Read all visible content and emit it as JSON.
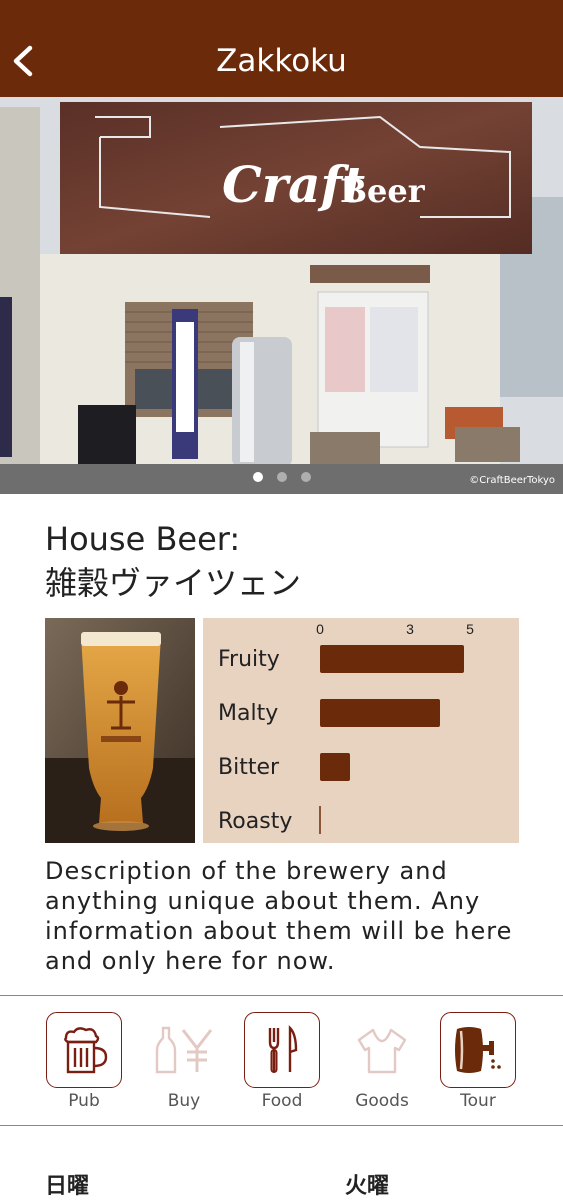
{
  "header": {
    "title": "Zakkoku",
    "back_icon": "chevron-left-icon"
  },
  "gallery": {
    "slide_count": 3,
    "active_index": 0,
    "watermark": "©CraftBeerTokyo",
    "sign_text": "Craft Beer"
  },
  "beer": {
    "heading": "House Beer:",
    "name": "雑穀ヴァイツェン"
  },
  "chart_data": {
    "type": "bar",
    "orientation": "horizontal",
    "categories": [
      "Fruity",
      "Malty",
      "Bitter",
      "Roasty"
    ],
    "values": [
      4.8,
      4.0,
      1.0,
      0
    ],
    "xlim": [
      0,
      5
    ],
    "ticks": [
      "0",
      "3",
      "5"
    ],
    "bar_color": "#6b2a0a",
    "background": "#e8d3c0",
    "grid": false
  },
  "description": "Description of the brewery and anything unique about them. Any information about them will be here and only here for now.",
  "amenities": [
    {
      "label": "Pub",
      "icon": "beer-mug-icon",
      "enabled": true
    },
    {
      "label": "Buy",
      "icon": "bottle-yen-icon",
      "enabled": false
    },
    {
      "label": "Food",
      "icon": "fork-knife-icon",
      "enabled": true
    },
    {
      "label": "Goods",
      "icon": "tshirt-icon",
      "enabled": false
    },
    {
      "label": "Tour",
      "icon": "keg-icon",
      "enabled": true
    }
  ],
  "hours": {
    "day1": "日曜",
    "day2": "火曜"
  },
  "colors": {
    "brand": "#6b2a0a",
    "icon_active": "#7a1e12",
    "icon_inactive": "#e3c9c3"
  }
}
